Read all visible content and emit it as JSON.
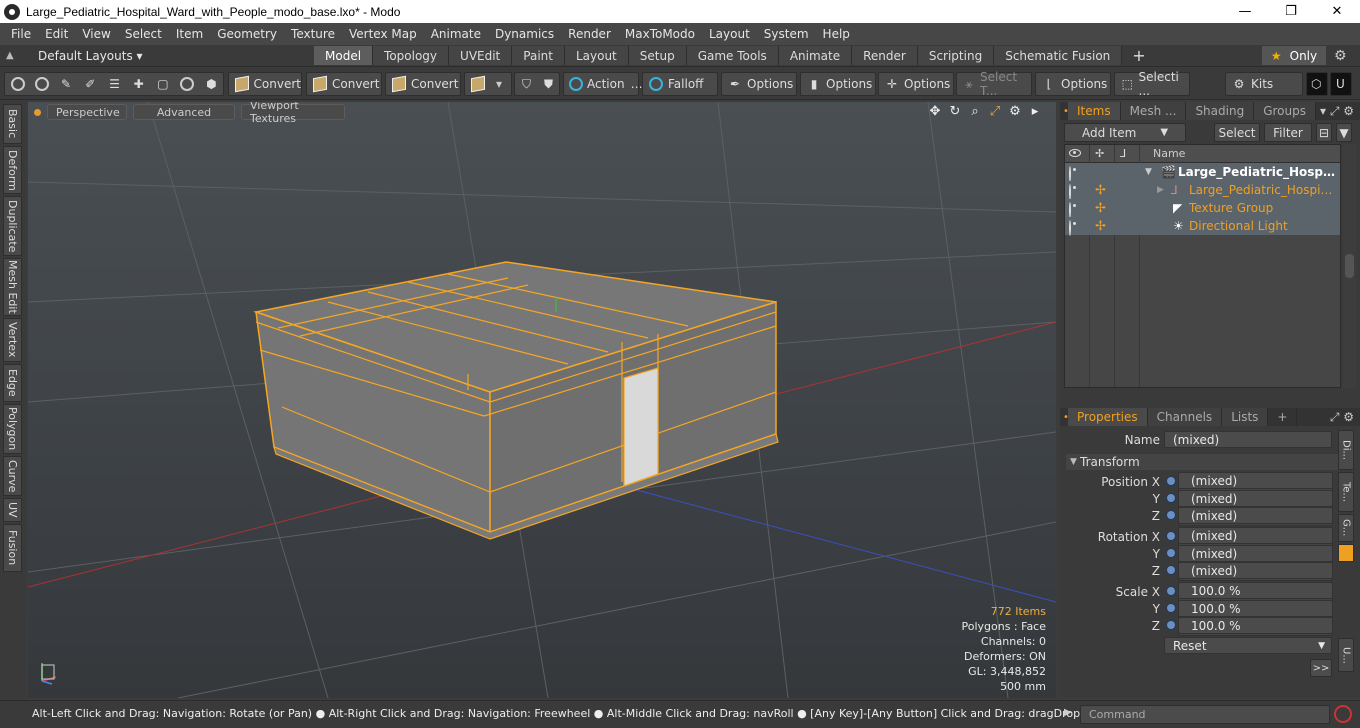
{
  "window": {
    "title": "Large_Pediatric_Hospital_Ward_with_People_modo_base.lxo* - Modo",
    "minimize": "—",
    "maximize": "❐",
    "close": "✕"
  },
  "menu": [
    "File",
    "Edit",
    "View",
    "Select",
    "Item",
    "Geometry",
    "Texture",
    "Vertex Map",
    "Animate",
    "Dynamics",
    "Render",
    "MaxToModo",
    "Layout",
    "System",
    "Help"
  ],
  "layouts": {
    "selector": "Default Layouts",
    "tabs": [
      {
        "label": "Model",
        "active": true
      },
      {
        "label": "Topology"
      },
      {
        "label": "UVEdit"
      },
      {
        "label": "Paint"
      },
      {
        "label": "Layout"
      },
      {
        "label": "Setup"
      },
      {
        "label": "Game Tools"
      },
      {
        "label": "Animate"
      },
      {
        "label": "Render"
      },
      {
        "label": "Scripting"
      },
      {
        "label": "Schematic Fusion"
      }
    ],
    "add": "+",
    "only": "Only"
  },
  "toolbar": {
    "convert1": "Convert",
    "convert2": "Convert",
    "convert3": "Convert",
    "action": "Action",
    "falloff": "Falloff",
    "options1": "Options",
    "options2": "Options",
    "options3": "Options",
    "select_t": "Select T...",
    "options4": "Options",
    "selecti": "Selecti ...",
    "kits": "Kits"
  },
  "left_tabs": [
    "Basic",
    "Deform",
    "Duplicate",
    "Mesh Edit",
    "Vertex",
    "Edge",
    "Polygon",
    "Curve",
    "UV",
    "Fusion"
  ],
  "viewport": {
    "perspective": "Perspective",
    "advanced": "Advanced",
    "textures": "Viewport Textures",
    "info": {
      "items": "772 Items",
      "polygons": "Polygons : Face",
      "channels": "Channels: 0",
      "deformers": "Deformers: ON",
      "gl": "GL: 3,448,852",
      "scale": "500 mm"
    }
  },
  "items_panel": {
    "tabs": [
      "Items",
      "Mesh ...",
      "Shading",
      "Groups"
    ],
    "add_item": "Add Item",
    "select": "Select",
    "filter": "Filter",
    "col_name": "Name",
    "rows": [
      {
        "label": "Large_Pediatric_Hospital_...",
        "bold": true
      },
      {
        "label": "Large_Pediatric_Hospital_W ..."
      },
      {
        "label": "Texture Group"
      },
      {
        "label": "Directional Light"
      }
    ]
  },
  "properties": {
    "tabs": [
      "Properties",
      "Channels",
      "Lists"
    ],
    "add": "+",
    "name_label": "Name",
    "name_value": "(mixed)",
    "transform": "Transform",
    "position_label": "Position X",
    "rotation_label": "Rotation X",
    "scale_label": "Scale X",
    "y": "Y",
    "z": "Z",
    "pos": [
      "(mixed)",
      "(mixed)",
      "(mixed)"
    ],
    "rot": [
      "(mixed)",
      "(mixed)",
      "(mixed)"
    ],
    "scl": [
      "100.0 %",
      "100.0 %",
      "100.0 %"
    ],
    "reset": "Reset",
    "more": ">>",
    "side_tabs": [
      "Di...",
      "Te...",
      "G...",
      "U..."
    ]
  },
  "status": {
    "message": "Alt-Left Click and Drag: Navigation: Rotate (or Pan) ● Alt-Right Click and Drag: Navigation: Freewheel ● Alt-Middle Click and Drag: navRoll ● [Any Key]-[Any Button] Click and Drag: dragDropBegin",
    "command_placeholder": "Command"
  },
  "colors": {
    "accent": "#f0a020",
    "selection_edge": "#f5a623"
  }
}
